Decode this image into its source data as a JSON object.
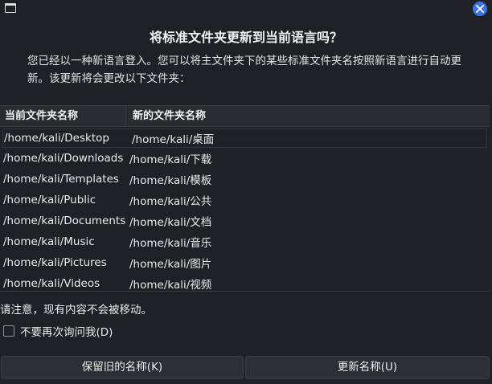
{
  "window": {
    "title_icon": "window-icon",
    "close_icon": "close-icon",
    "accent": "#3b74e0"
  },
  "dialog": {
    "heading": "将标准文件夹更新到当前语言吗？",
    "description": "您已经以一种新语言登入。您可以将主文件夹下的某些标准文件夹名按照新语言进行自动更新。该更新将会更改以下文件夹：",
    "notice": "请注意，现有内容不会被移动。",
    "dont_ask_label": "不要再次询问我(D)",
    "dont_ask_checked": false
  },
  "table": {
    "headers": [
      "当前文件夹名称",
      "新的文件夹名称"
    ],
    "rows": [
      {
        "current": "/home/kali/Desktop",
        "new": "/home/kali/桌面"
      },
      {
        "current": "/home/kali/Downloads",
        "new": "/home/kali/下载"
      },
      {
        "current": "/home/kali/Templates",
        "new": "/home/kali/模板"
      },
      {
        "current": "/home/kali/Public",
        "new": "/home/kali/公共"
      },
      {
        "current": "/home/kali/Documents",
        "new": "/home/kali/文档"
      },
      {
        "current": "/home/kali/Music",
        "new": "/home/kali/音乐"
      },
      {
        "current": "/home/kali/Pictures",
        "new": "/home/kali/图片"
      },
      {
        "current": "/home/kali/Videos",
        "new": "/home/kali/视频"
      }
    ]
  },
  "buttons": {
    "keep_label": "保留旧的名称(K)",
    "update_label": "更新名称(U)"
  }
}
